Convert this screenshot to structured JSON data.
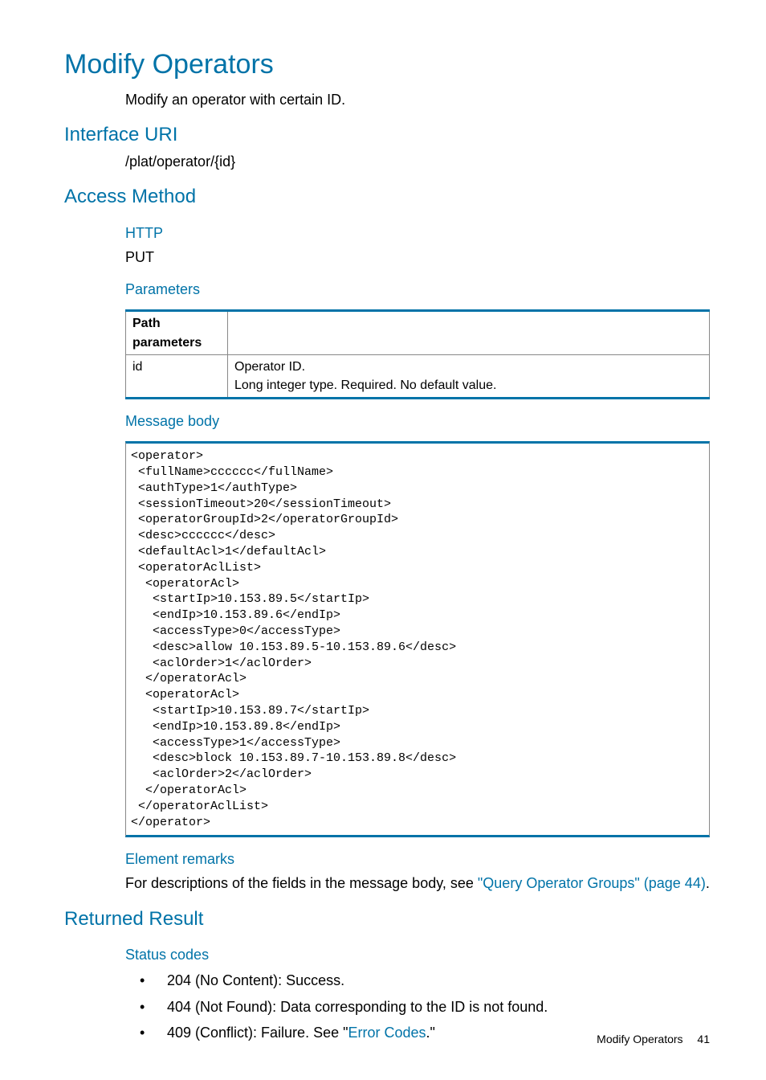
{
  "title": "Modify Operators",
  "intro": "Modify an operator with certain ID.",
  "interface_uri": {
    "heading": "Interface URI",
    "value": "/plat/operator/{id}"
  },
  "access_method": {
    "heading": "Access Method",
    "http_label": "HTTP",
    "http_value": "PUT",
    "parameters_label": "Parameters",
    "table": {
      "header": "Path parameters",
      "param_name": "id",
      "desc_line1": "Operator ID.",
      "desc_line2": "Long integer type. Required. No default value."
    },
    "message_body_label": "Message body",
    "message_body_code": "<operator>\n <fullName>cccccc</fullName>\n <authType>1</authType>\n <sessionTimeout>20</sessionTimeout>\n <operatorGroupId>2</operatorGroupId>\n <desc>cccccc</desc>\n <defaultAcl>1</defaultAcl>\n <operatorAclList>\n  <operatorAcl>\n   <startIp>10.153.89.5</startIp>\n   <endIp>10.153.89.6</endIp>\n   <accessType>0</accessType>\n   <desc>allow 10.153.89.5-10.153.89.6</desc>\n   <aclOrder>1</aclOrder>\n  </operatorAcl>\n  <operatorAcl>\n   <startIp>10.153.89.7</startIp>\n   <endIp>10.153.89.8</endIp>\n   <accessType>1</accessType>\n   <desc>block 10.153.89.7-10.153.89.8</desc>\n   <aclOrder>2</aclOrder>\n  </operatorAcl>\n </operatorAclList>\n</operator>",
    "element_remarks_label": "Element remarks",
    "element_remarks_prefix": "For descriptions of the fields in the message body, see ",
    "element_remarks_link": "\"Query Operator Groups\" (page 44)",
    "element_remarks_suffix": "."
  },
  "returned_result": {
    "heading": "Returned Result",
    "status_codes_label": "Status codes",
    "items": [
      {
        "prefix": "204 (No Content): Success."
      },
      {
        "prefix": "404 (Not Found): Data corresponding to the ID is not found."
      },
      {
        "prefix": "409 (Conflict): Failure. See \"",
        "link": "Error Codes",
        "suffix": ".\""
      }
    ]
  },
  "footer": {
    "section": "Modify Operators",
    "page": "41"
  }
}
